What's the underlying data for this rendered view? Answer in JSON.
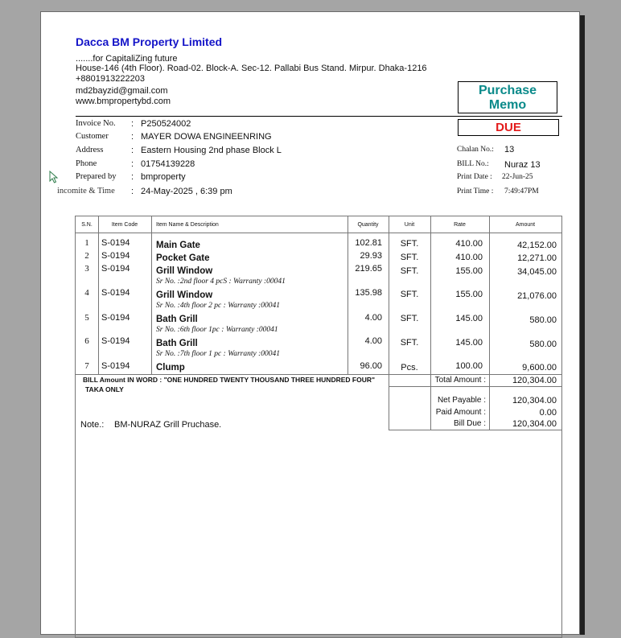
{
  "company": {
    "name": "Dacca BM Property Limited",
    "tagline": ".......for CapitaliZing future",
    "address": "House-146 (4th Floor). Road-02. Block-A. Sec-12. Pallabi Bus Stand. Mirpur. Dhaka-1216",
    "phone": "+8801913222203",
    "email": "md2bayzid@gmail.com",
    "website": "www.bmpropertybd.com"
  },
  "memo": {
    "title_line1": "Purchase",
    "title_line2": "Memo",
    "status": "DUE"
  },
  "info": {
    "invoice_label": "Invoice No.",
    "invoice_value": "P250524002",
    "customer_label": "Customer",
    "customer_value": "MAYER DOWA ENGINEENRING",
    "address_label": "Address",
    "address_value": "Eastern Housing 2nd phase Block L",
    "phone_label": "Phone",
    "phone_value": "01754139228",
    "prepared_label": "Prepared by",
    "prepared_value": "bmproperty",
    "datetime_label": "incomite & Time",
    "datetime_value": "24-May-2025 ,  6:39 pm",
    "colon": ":"
  },
  "side_info": {
    "chalan_label": "Chalan No.:",
    "chalan_value": "13",
    "bill_label": "BILL No.:",
    "bill_value": "Nuraz 13",
    "print_date_label": "Print Date :",
    "print_date_value": "22-Jun-25",
    "print_time_label": "Print Time :",
    "print_time_value": "7:49:47PM"
  },
  "table": {
    "headers": {
      "sn": "S.N.",
      "code": "Item Code",
      "name": "Item Name & Description",
      "qty": "Quantity",
      "unit": "Unit",
      "rate": "Rate",
      "amount": "Amount"
    },
    "rows": [
      {
        "sn": "1",
        "code": "S-0194",
        "name": "Main Gate",
        "desc": "",
        "qty": "102.81",
        "unit": "SFT.",
        "rate": "410.00",
        "amount": "42,152.00"
      },
      {
        "sn": "2",
        "code": "S-0194",
        "name": "Pocket Gate",
        "desc": "",
        "qty": "29.93",
        "unit": "SFT.",
        "rate": "410.00",
        "amount": "12,271.00"
      },
      {
        "sn": "3",
        "code": "S-0194",
        "name": "Grill Window",
        "desc": "Sr No. :2nd floor 4 pcS : Warranty :00041",
        "qty": "219.65",
        "unit": "SFT.",
        "rate": "155.00",
        "amount": "34,045.00"
      },
      {
        "sn": "4",
        "code": "S-0194",
        "name": "Grill Window",
        "desc": "Sr No. :4th floor 2 pc : Warranty :00041",
        "qty": "135.98",
        "unit": "SFT.",
        "rate": "155.00",
        "amount": "21,076.00"
      },
      {
        "sn": "5",
        "code": "S-0194",
        "name": "Bath Grill",
        "desc": "Sr No. :6th floor 1pc : Warranty :00041",
        "qty": "4.00",
        "unit": "SFT.",
        "rate": "145.00",
        "amount": "580.00"
      },
      {
        "sn": "6",
        "code": "S-0194",
        "name": "Bath Grill",
        "desc": "Sr No. :7th floor 1 pc : Warranty :00041",
        "qty": "4.00",
        "unit": "SFT.",
        "rate": "145.00",
        "amount": "580.00"
      },
      {
        "sn": "7",
        "code": "S-0194",
        "name": "Clump",
        "desc": "",
        "qty": "96.00",
        "unit": "Pcs.",
        "rate": "100.00",
        "amount": "9,600.00"
      }
    ]
  },
  "totals": {
    "words_line1": "BILL Amount IN WORD :  \"ONE HUNDRED TWENTY THOUSAND THREE HUNDRED FOUR\"",
    "words_line2": "TAKA ONLY",
    "total_label": "Total Amount :",
    "total_value": "120,304.00",
    "net_label": "Net Payable :",
    "net_value": "120,304.00",
    "paid_label": "Paid Amount :",
    "paid_value": "0.00",
    "due_label": "Bill Due :",
    "due_value": "120,304.00"
  },
  "note": {
    "label": "Note.:",
    "value": "BM-NURAZ Grill Pruchase."
  }
}
